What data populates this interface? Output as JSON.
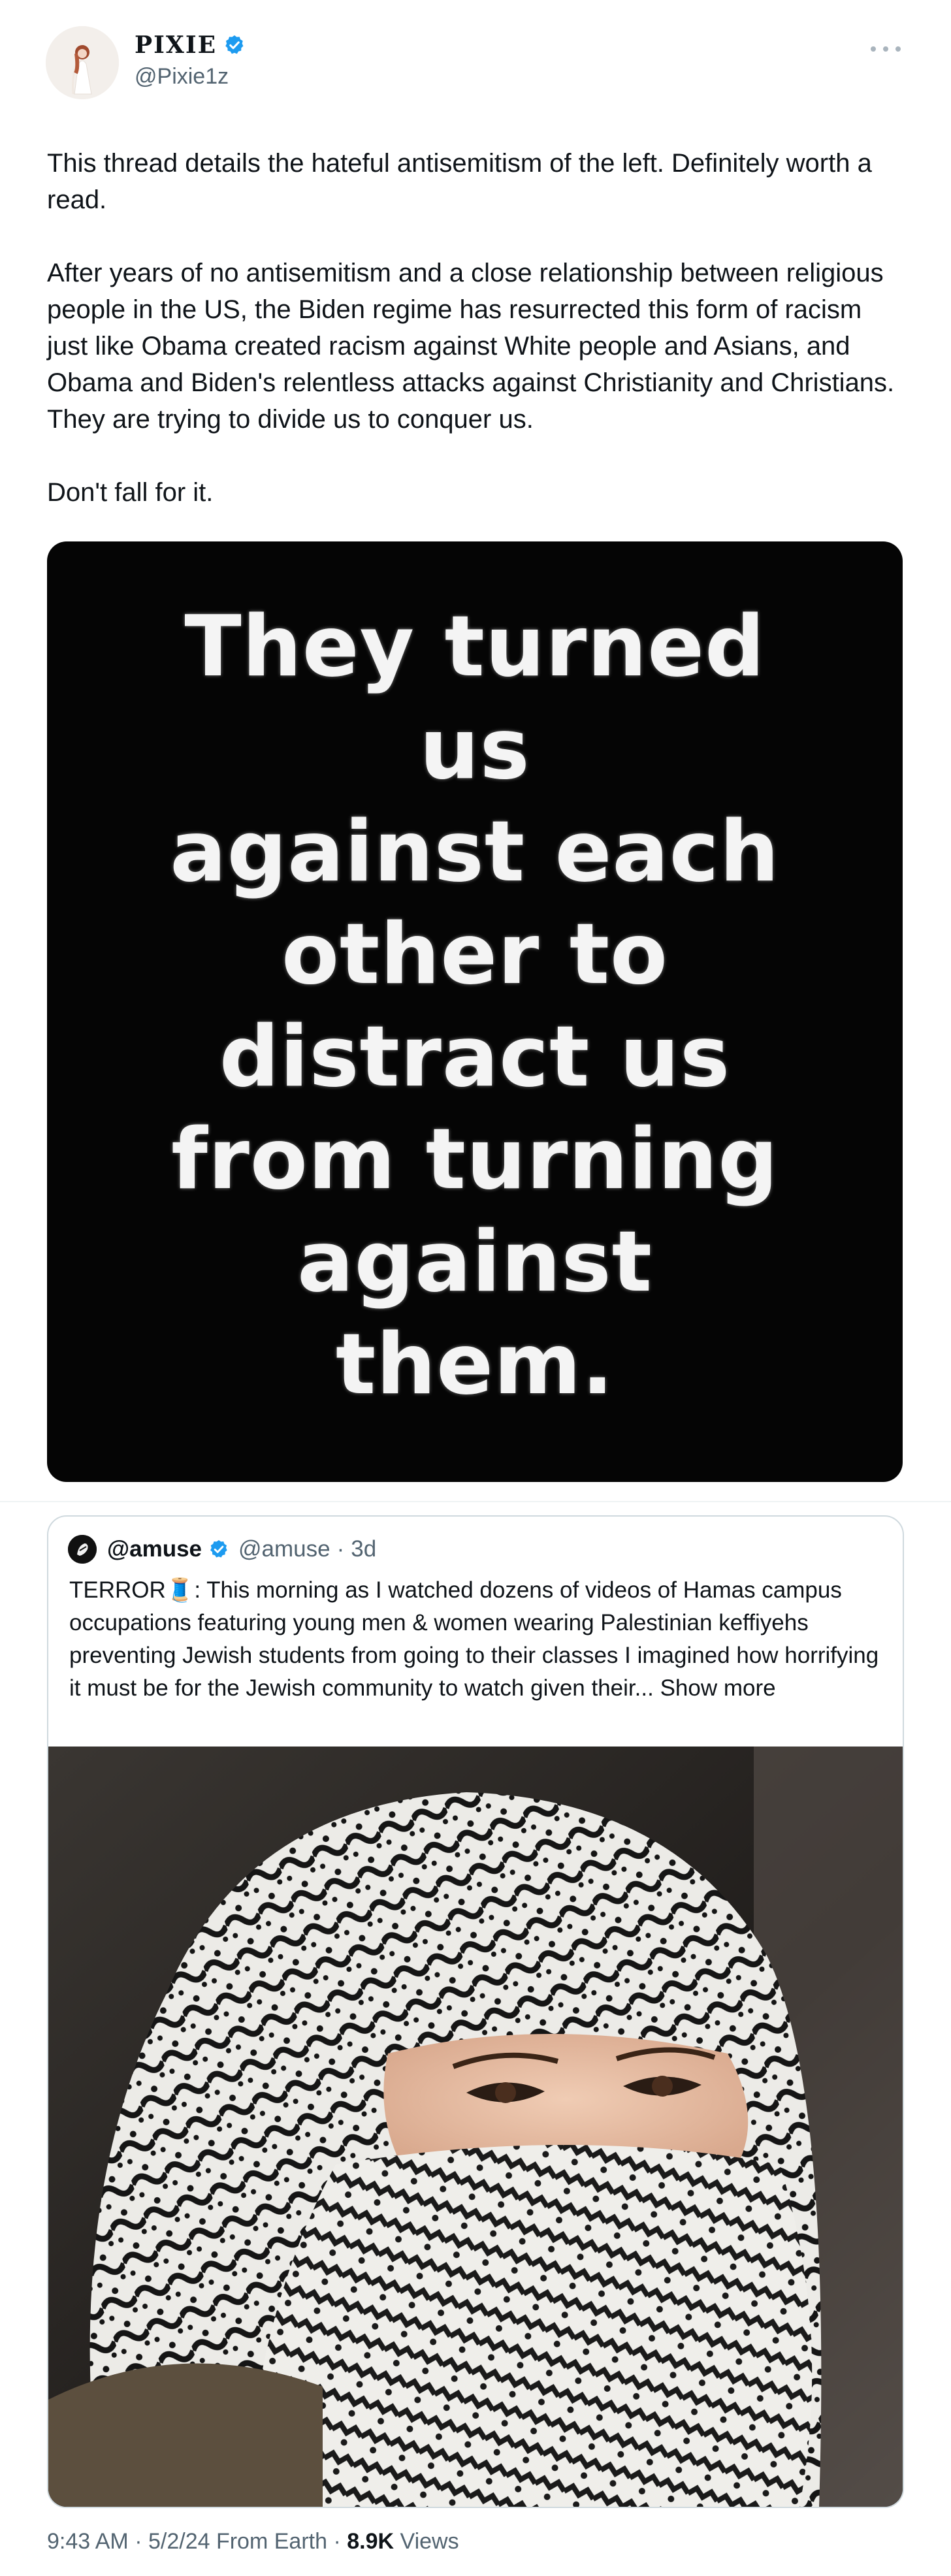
{
  "author": {
    "display_name": "PIXIE",
    "handle": "@Pixie1z",
    "verified": true
  },
  "tweet": {
    "paragraphs": [
      "This thread details the hateful antisemitism of the left. Definitely worth a read.",
      "After years of no antisemitism and a close relationship between religious people in the US, the Biden regime has resurrected this form of racism just like Obama created racism against White people and Asians, and Obama and Biden's relentless attacks against Christianity and Christians. They are trying to divide us to conquer us.",
      "Don't fall for it."
    ],
    "image_text": [
      "They turned us",
      "against each",
      "other to",
      "distract us",
      "from turning",
      "against",
      "them."
    ]
  },
  "quote": {
    "display_name": "@amuse",
    "handle": "@amuse",
    "separator": "·",
    "age": "3d",
    "verified": true,
    "text": "TERROR🧵: This morning as I watched dozens of videos of Hamas campus occupations featuring young men & women wearing Palestinian keffiyehs preventing Jewish students from going to their classes I imagined how horrifying it must be for the Jewish community to watch given their...",
    "show_more": "Show more",
    "image_alt": "person wearing black and white keffiyeh"
  },
  "footer": {
    "time": "9:43 AM",
    "date": "5/2/24",
    "source": "From Earth",
    "sep": "·",
    "views_count": "8.9K",
    "views_label": "Views"
  },
  "colors": {
    "verified_blue": "#1d9bf0",
    "text_primary": "#0f1419",
    "text_secondary": "#536471",
    "border": "#cfd9de"
  },
  "icons": [
    "verified-icon",
    "more-icon"
  ]
}
